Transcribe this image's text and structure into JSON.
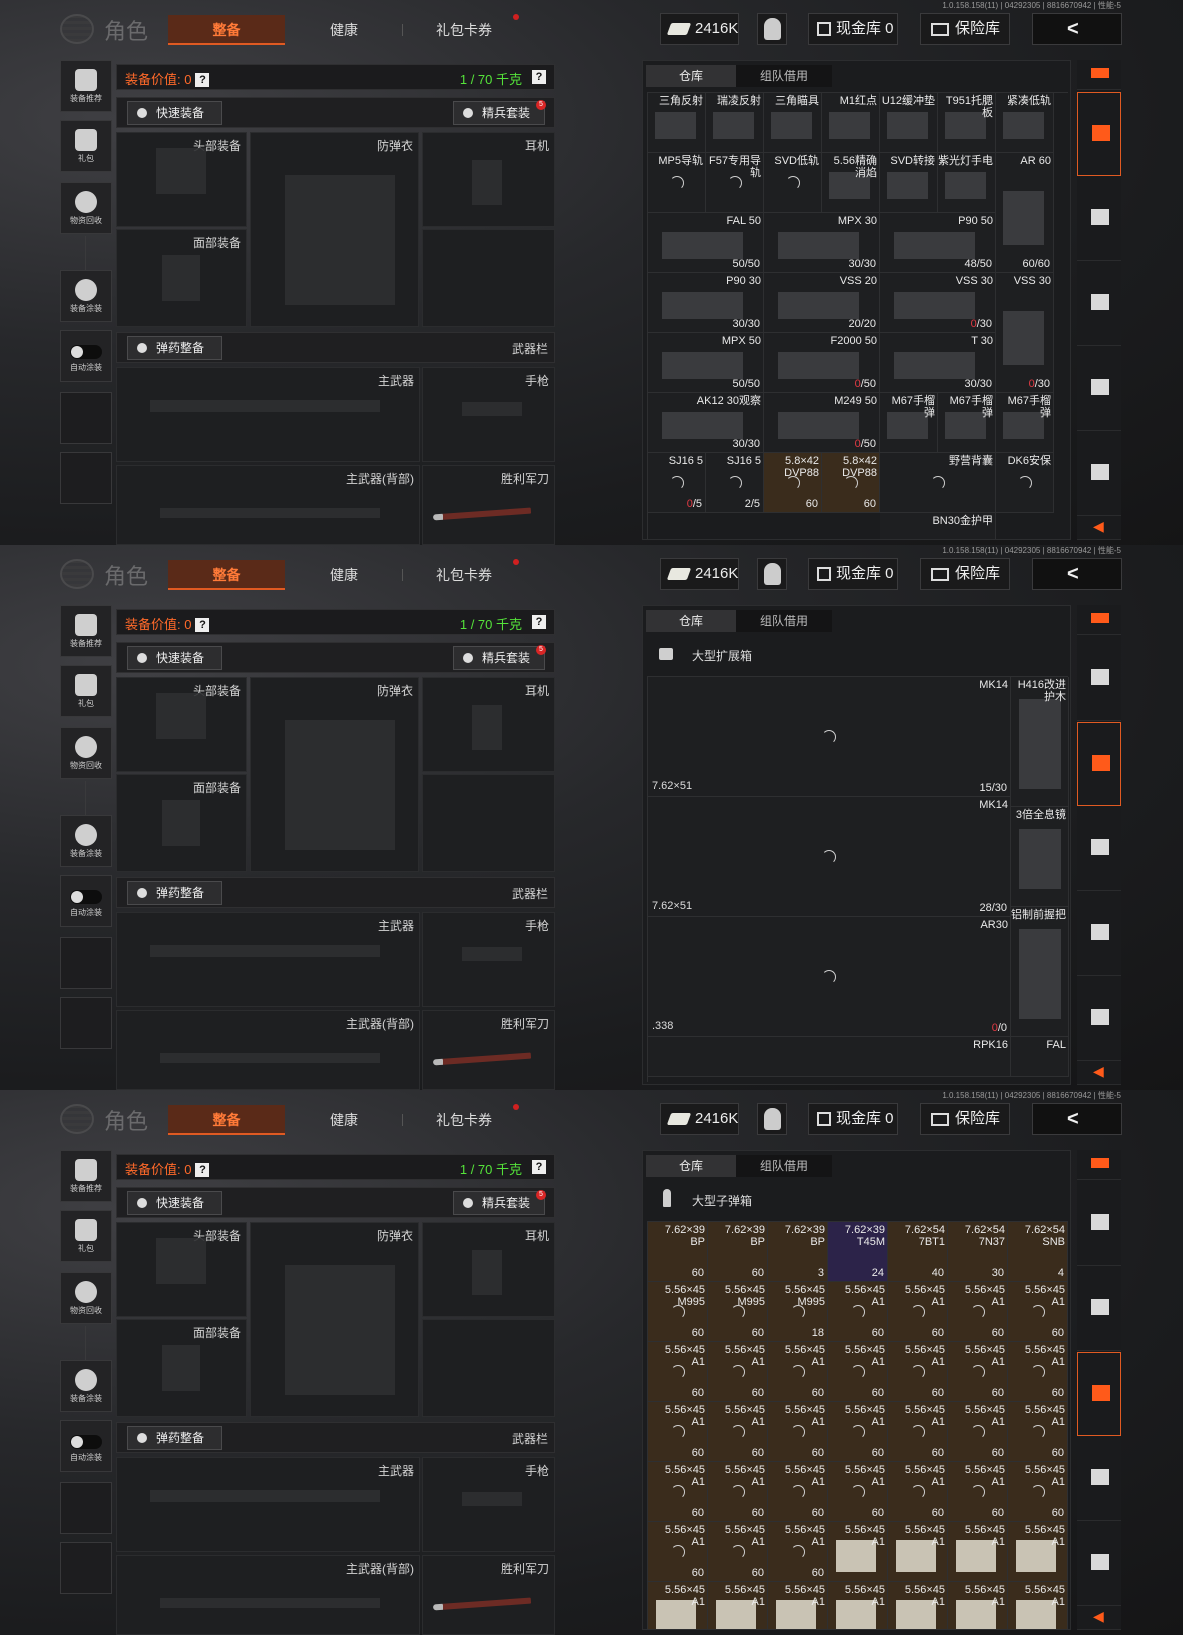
{
  "header": {
    "version": "1.0.158.158(11) | 04292305 | 8816670942 | 性能-5",
    "title": "角色",
    "tabs": [
      "整备",
      "健康",
      "礼包卡券"
    ],
    "money": "2416K",
    "cash": "现金库 0",
    "vault": "保险库"
  },
  "sidebar": [
    "装备推荐",
    "礼包",
    "物资回收",
    "装备涂装",
    "自动涂装"
  ],
  "loadout": {
    "value_label": "装备价值: 0",
    "weight": "1 / 70 千克",
    "quick": "快速装备",
    "elite": "精兵套装",
    "elite_badge": "5",
    "ammo": "弹药整备",
    "slots": {
      "head": "头部装备",
      "armor": "防弹衣",
      "ear": "耳机",
      "face": "面部装备",
      "weapons": "武器栏",
      "primary": "主武器",
      "pistol": "手枪",
      "primary_back": "主武器(背部)",
      "knife": "胜利军刀"
    }
  },
  "storage": {
    "tab_warehouse": "仓库",
    "tab_team": "组队借用",
    "sub2": "大型扩展箱",
    "sub3": "大型子弹箱"
  },
  "grid1": [
    {
      "n": "三角反射",
      "c": ""
    },
    {
      "n": "瑞凌反射",
      "c": ""
    },
    {
      "n": "三角瞄具",
      "c": ""
    },
    {
      "n": "M1红点",
      "c": ""
    },
    {
      "n": "U12缓冲垫",
      "c": ""
    },
    {
      "n": "T951托腮\n板",
      "c": ""
    },
    {
      "n": "紧凑低轨",
      "c": ""
    },
    {
      "n": "MP5导轨",
      "c": ""
    },
    {
      "n": "F57专用导\n轨",
      "c": ""
    },
    {
      "n": "SVD低轨",
      "c": ""
    },
    {
      "n": "5.56精确\n消焰",
      "c": ""
    },
    {
      "n": "SVD转接",
      "c": ""
    },
    {
      "n": "紫光灯手电",
      "c": ""
    },
    {
      "n": "AR 60",
      "c": "60/60"
    },
    {
      "n": "FAL 50",
      "c": "50/50"
    },
    {
      "n": "MPX 30",
      "c": "30/30"
    },
    {
      "n": "P90 50",
      "c": "48/50"
    },
    {
      "n": "P90 30",
      "c": "30/30"
    },
    {
      "n": "VSS 20",
      "c": "20/20"
    },
    {
      "n": "VSS 30",
      "c": "0/30"
    },
    {
      "n": "VSS 30",
      "c": "0/30"
    },
    {
      "n": "MPX 50",
      "c": "50/50"
    },
    {
      "n": "F2000 50",
      "c": "0/50"
    },
    {
      "n": "T 30",
      "c": "30/30"
    },
    {
      "n": "AK12 30观察",
      "c": "30/30"
    },
    {
      "n": "M249 50",
      "c": "0/50"
    },
    {
      "n": "M67手榴\n弹",
      "c": ""
    },
    {
      "n": "M67手榴\n弹",
      "c": ""
    },
    {
      "n": "M67手榴\n弹",
      "c": ""
    },
    {
      "n": "SJ16 5",
      "c": "0/5"
    },
    {
      "n": "SJ16 5",
      "c": "2/5"
    },
    {
      "n": "5.8×42\nDVP88",
      "c": "60"
    },
    {
      "n": "5.8×42\nDVP88",
      "c": "60"
    },
    {
      "n": "野营背囊",
      "c": ""
    },
    {
      "n": "DK6安保",
      "c": ""
    },
    {
      "n": "BN30金护甲",
      "c": ""
    }
  ],
  "grid2": [
    {
      "n": "MK14",
      "cal": "7.62×51",
      "c": "15/30"
    },
    {
      "n": "MK14",
      "cal": "7.62×51",
      "c": "28/30"
    },
    {
      "n": "AR30",
      "cal": ".338",
      "c": "0/0"
    },
    {
      "n": "RPK16",
      "cal": "",
      "c": ""
    },
    {
      "n": "H416改进\n护木",
      "c": ""
    },
    {
      "n": "3倍全息镜",
      "c": ""
    },
    {
      "n": "铝制前握把",
      "c": ""
    },
    {
      "n": "FAL",
      "c": ""
    }
  ],
  "grid3": [
    {
      "n": "7.62×39\nBP",
      "c": "60"
    },
    {
      "n": "7.62×39\nBP",
      "c": "60"
    },
    {
      "n": "7.62×39\nBP",
      "c": "3"
    },
    {
      "n": "7.62×39\nT45M",
      "c": "24"
    },
    {
      "n": "7.62×54\n7BT1",
      "c": "40"
    },
    {
      "n": "7.62×54\n7N37",
      "c": "30"
    },
    {
      "n": "7.62×54\nSNB",
      "c": "4"
    },
    {
      "n": "5.56×45\nM995",
      "c": "60"
    },
    {
      "n": "5.56×45\nM995",
      "c": "60"
    },
    {
      "n": "5.56×45\nM995",
      "c": "18"
    },
    {
      "n": "5.56×45\nA1",
      "c": "60"
    },
    {
      "n": "5.56×45\nA1",
      "c": "60"
    },
    {
      "n": "5.56×45\nA1",
      "c": "60"
    },
    {
      "n": "5.56×45\nA1",
      "c": "60"
    },
    {
      "n": "5.56×45\nA1",
      "c": "60"
    },
    {
      "n": "5.56×45\nA1",
      "c": "60"
    },
    {
      "n": "5.56×45\nA1",
      "c": "60"
    },
    {
      "n": "5.56×45\nA1",
      "c": "60"
    },
    {
      "n": "5.56×45\nA1",
      "c": "60"
    },
    {
      "n": "5.56×45\nA1",
      "c": "60"
    },
    {
      "n": "5.56×45\nA1",
      "c": "60"
    },
    {
      "n": "5.56×45\nA1",
      "c": "60"
    },
    {
      "n": "5.56×45\nA1",
      "c": "60"
    },
    {
      "n": "5.56×45\nA1",
      "c": "60"
    },
    {
      "n": "5.56×45\nA1",
      "c": "60"
    },
    {
      "n": "5.56×45\nA1",
      "c": "60"
    },
    {
      "n": "5.56×45\nA1",
      "c": "60"
    },
    {
      "n": "5.56×45\nA1",
      "c": "60"
    },
    {
      "n": "5.56×45\nA1",
      "c": "60"
    },
    {
      "n": "5.56×45\nA1",
      "c": "60"
    },
    {
      "n": "5.56×45\nA1",
      "c": "60"
    },
    {
      "n": "5.56×45\nA1",
      "c": "60"
    },
    {
      "n": "5.56×45\nA1",
      "c": "60"
    },
    {
      "n": "5.56×45\nA1",
      "c": "60"
    },
    {
      "n": "5.56×45\nA1",
      "c": "60"
    },
    {
      "n": "5.56×45\nA1",
      "c": "60"
    },
    {
      "n": "5.56×45\nA1",
      "c": "60"
    },
    {
      "n": "5.56×45\nA1",
      "c": "60"
    },
    {
      "n": "5.56×45\nA1",
      "c": ""
    },
    {
      "n": "5.56×45\nA1",
      "c": ""
    },
    {
      "n": "5.56×45\nA1",
      "c": ""
    },
    {
      "n": "5.56×45\nA1",
      "c": ""
    },
    {
      "n": "5.56×45\nA1",
      "c": ""
    },
    {
      "n": "5.56×45\nA1",
      "c": ""
    },
    {
      "n": "5.56×45\nA1",
      "c": ""
    },
    {
      "n": "5.56×45\nA1",
      "c": ""
    },
    {
      "n": "5.56×45\nA1",
      "c": ""
    },
    {
      "n": "5.56×45\nA1",
      "c": ""
    },
    {
      "n": "5.56×45\nA1",
      "c": ""
    }
  ]
}
